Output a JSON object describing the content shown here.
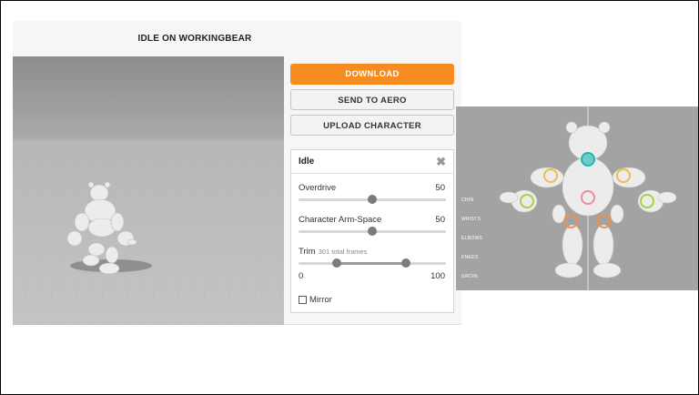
{
  "title": "IDLE ON WORKINGBEAR",
  "buttons": {
    "download": "DOWNLOAD",
    "send_to_aero": "SEND TO AERO",
    "upload_character": "UPLOAD CHARACTER"
  },
  "settings": {
    "title": "Idle",
    "overdrive": {
      "label": "Overdrive",
      "value": "50",
      "fraction": 0.5
    },
    "arm_space": {
      "label": "Character Arm-Space",
      "value": "50",
      "fraction": 0.5
    },
    "trim": {
      "label": "Trim",
      "sublabel": "301 total frames",
      "min": "0",
      "max": "100",
      "start_fraction": 0.26,
      "end_fraction": 0.73
    },
    "mirror": {
      "label": "Mirror",
      "checked": false
    }
  },
  "rig_labels": [
    "CHIN",
    "WRISTS",
    "ELBOWS",
    "KNEES",
    "GROIN"
  ],
  "colors": {
    "accent": "#f68b1f",
    "marker_yellow": "#e8c04a",
    "marker_green": "#a8d04a",
    "marker_orange": "#f0904a",
    "marker_pink": "#f08aa0",
    "marker_teal": "#1fb6b0"
  }
}
